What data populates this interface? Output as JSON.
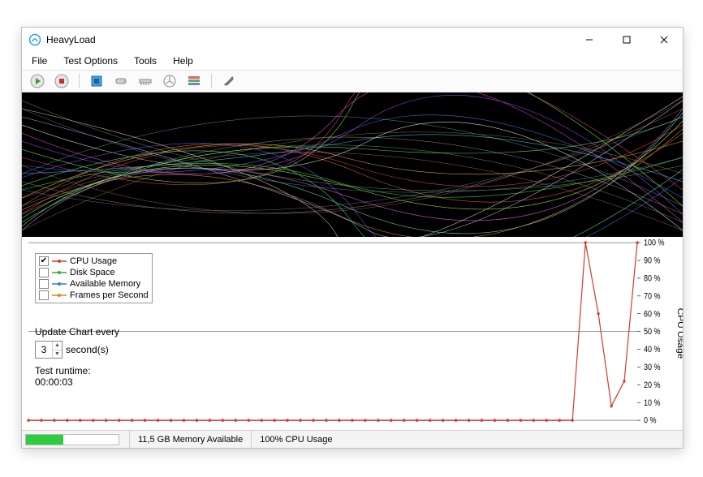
{
  "window": {
    "title": "HeavyLoad"
  },
  "menu": {
    "file": "File",
    "test_options": "Test Options",
    "tools": "Tools",
    "help": "Help"
  },
  "toolbar": {
    "play": "play",
    "stop": "stop",
    "cpu": "cpu",
    "disk": "disk",
    "memory": "memory",
    "gpu": "gpu",
    "treesize": "treesize",
    "settings": "settings"
  },
  "legend": {
    "items": [
      {
        "label": "CPU Usage",
        "checked": true,
        "color": "#d43a2f"
      },
      {
        "label": "Disk Space",
        "checked": false,
        "color": "#3aa63a"
      },
      {
        "label": "Available Memory",
        "checked": false,
        "color": "#2f7fd4"
      },
      {
        "label": "Frames per Second",
        "checked": false,
        "color": "#e0861f"
      }
    ]
  },
  "update": {
    "label": "Update Chart every",
    "value": "3",
    "unit": "second(s)"
  },
  "runtime": {
    "label": "Test runtime:",
    "value": "00:00:03"
  },
  "status": {
    "memory": "11,5 GB Memory Available",
    "cpu": "100% CPU Usage",
    "progress_pct": 40
  },
  "chart_data": {
    "type": "line",
    "title": "",
    "xlabel": "",
    "ylabel": "CPU Usage",
    "ylim": [
      0,
      100
    ],
    "yticks": [
      "0 %",
      "10 %",
      "20 %",
      "30 %",
      "40 %",
      "50 %",
      "60 %",
      "70 %",
      "80 %",
      "90 %",
      "100 %"
    ],
    "gridlines_y": [
      0,
      50,
      100
    ],
    "series": [
      {
        "name": "CPU Usage",
        "color": "#d43a2f",
        "values": [
          0,
          0,
          0,
          0,
          0,
          0,
          0,
          0,
          0,
          0,
          0,
          0,
          0,
          0,
          0,
          0,
          0,
          0,
          0,
          0,
          0,
          0,
          0,
          0,
          0,
          0,
          0,
          0,
          0,
          0,
          0,
          0,
          0,
          0,
          0,
          0,
          0,
          0,
          0,
          0,
          0,
          0,
          0,
          100,
          60,
          8,
          22,
          100
        ]
      }
    ]
  }
}
